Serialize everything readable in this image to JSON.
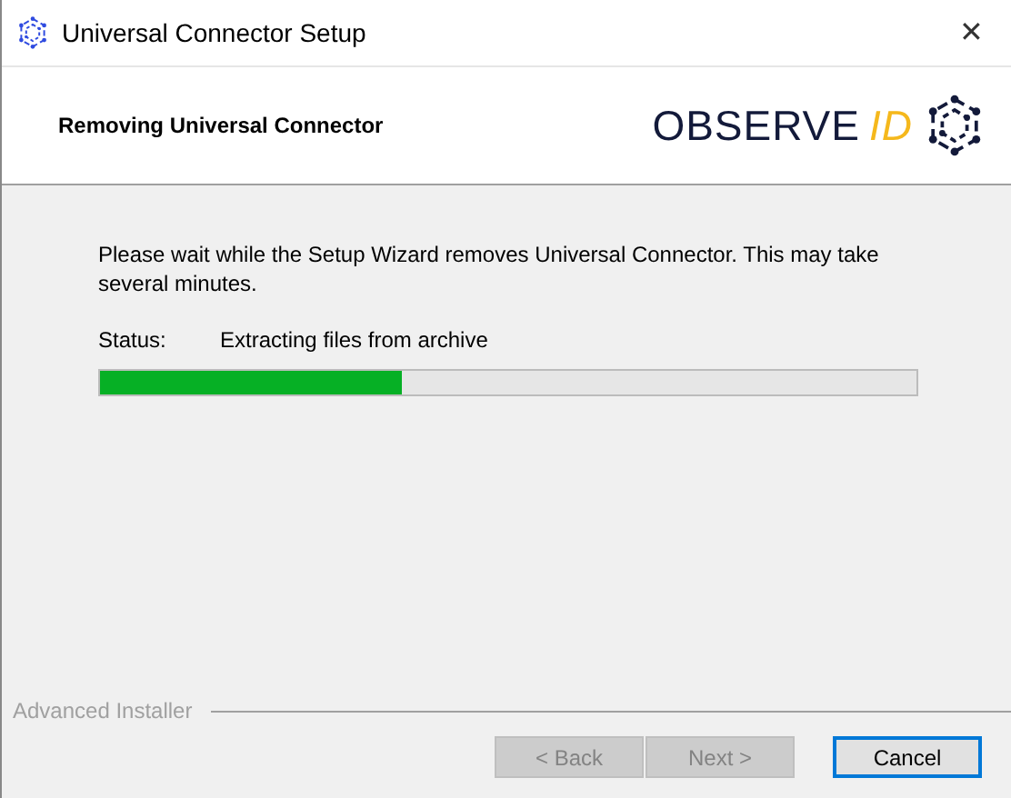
{
  "window": {
    "title": "Universal Connector Setup",
    "close": "✕"
  },
  "header": {
    "title": "Removing Universal Connector",
    "logo_text": "OBSERVE",
    "logo_accent": "ID"
  },
  "body": {
    "message": "Please wait while the Setup Wizard removes Universal Connector.  This may take several minutes.",
    "status_label": "Status:",
    "status_value": "Extracting files from archive",
    "progress": {
      "level": 0.37
    }
  },
  "footer": {
    "brand": "Advanced Installer",
    "buttons": [
      {
        "label": "< Back",
        "disabled": true,
        "default": false
      },
      {
        "label": "Next >",
        "disabled": true,
        "default": false
      },
      {
        "label": "Cancel",
        "disabled": false,
        "default": true
      }
    ]
  }
}
